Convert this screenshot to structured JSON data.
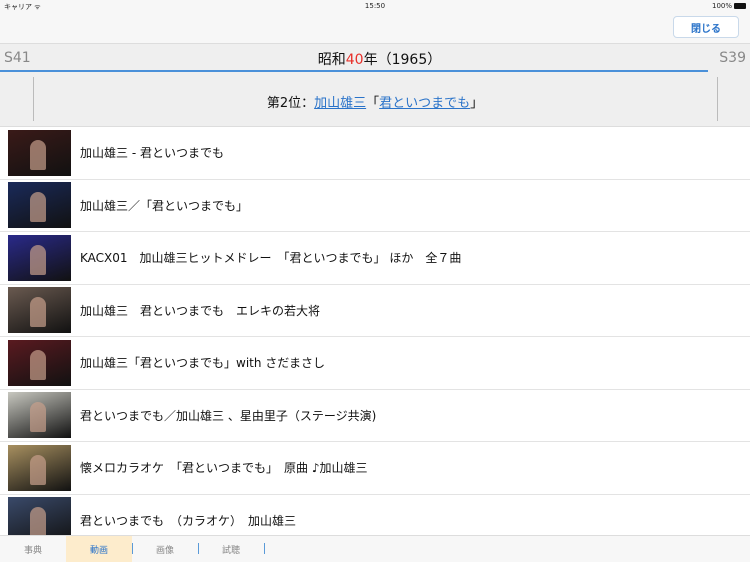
{
  "status": {
    "carrier": "キャリア ᯤ",
    "time": "15:50",
    "battery": "100%"
  },
  "nav": {
    "close_label": "閉じる"
  },
  "year": {
    "prev": "S41",
    "next": "S39",
    "prefix": "昭和",
    "number": "40",
    "suffix": "年（1965）"
  },
  "rank": {
    "prefix": "第2位：",
    "artist": "加山雄三",
    "open": "「",
    "song": "君といつまでも",
    "close": "」"
  },
  "videos": [
    {
      "title": "加山雄三 - 君といつまでも",
      "thumb": "#3a1a18"
    },
    {
      "title": "加山雄三／「君といつまでも」",
      "thumb": "#1a2a5a"
    },
    {
      "title": "KACX01　加山雄三ヒットメドレー　「君といつまでも」 ほか　全７曲",
      "thumb": "#2a2a8a"
    },
    {
      "title": "加山雄三　君といつまでも　エレキの若大将",
      "thumb": "#6a5a50"
    },
    {
      "title": "加山雄三「君といつまでも」with さだまさし",
      "thumb": "#5a1a20"
    },
    {
      "title": "君といつまでも／加山雄三 、星由里子（ステージ共演)",
      "thumb": "#c8c8c0"
    },
    {
      "title": "懐メロカラオケ　「君といつまでも」　原曲 ♪加山雄三",
      "thumb": "#a89060"
    },
    {
      "title": "君といつまでも　（カラオケ）　加山雄三",
      "thumb": "#3a4a6a"
    }
  ],
  "tabs": [
    "事典",
    "動画",
    "画像",
    "試聴"
  ],
  "active_tab": 1
}
